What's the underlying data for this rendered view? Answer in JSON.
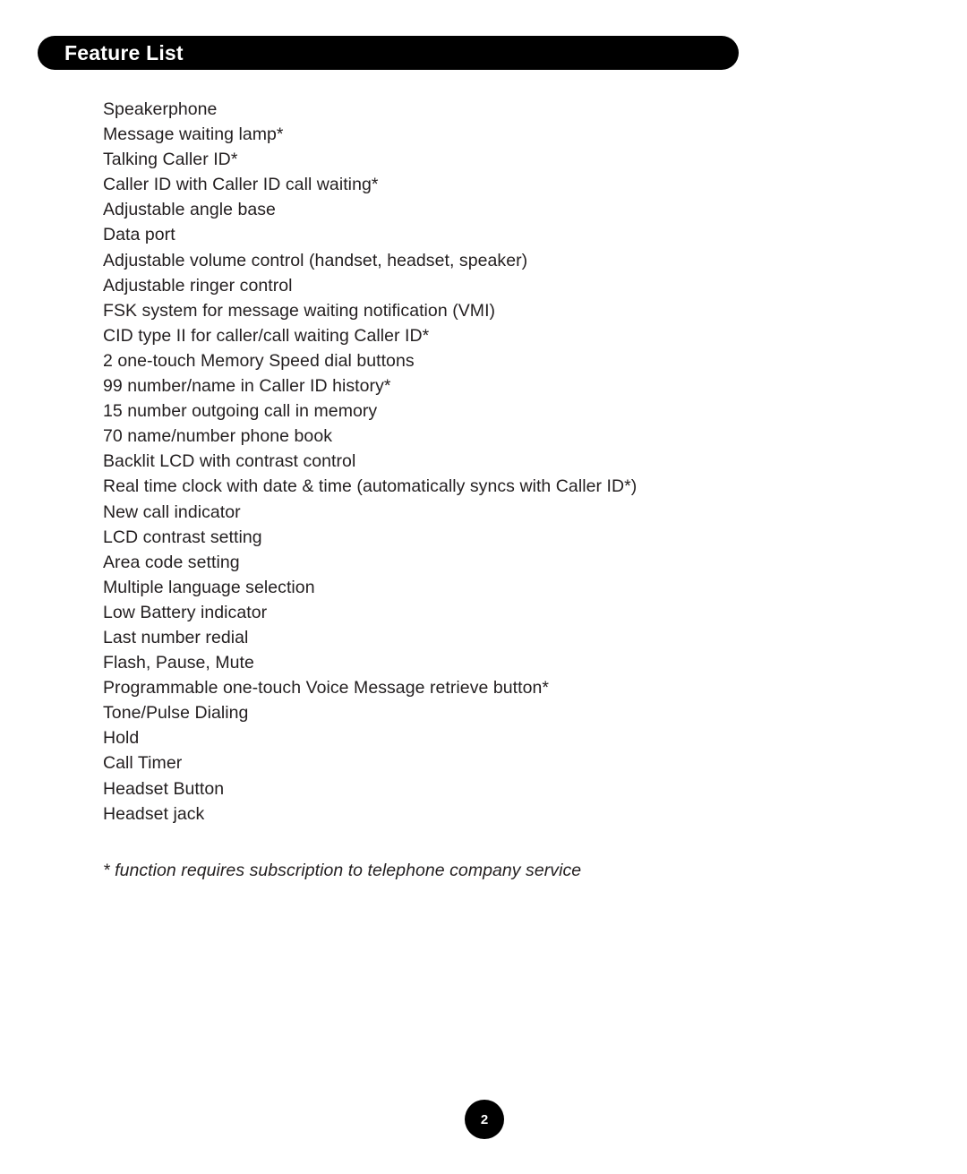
{
  "header": {
    "title": "Feature List",
    "background_color": "#000000",
    "text_color": "#ffffff"
  },
  "body_text_color": "#231f20",
  "page_background_color": "#ffffff",
  "features": [
    "Speakerphone",
    "Message waiting lamp*",
    "Talking Caller ID*",
    "Caller ID with Caller ID call waiting*",
    "Adjustable angle base",
    "Data port",
    "Adjustable volume control (handset, headset, speaker)",
    "Adjustable ringer control",
    "FSK system for message waiting notification (VMI)",
    "CID type II for caller/call waiting Caller ID*",
    "2 one-touch Memory Speed dial buttons",
    "99 number/name in Caller ID history*",
    "15 number outgoing call in memory",
    "70 name/number phone book",
    "Backlit LCD with contrast control",
    "Real time clock with date & time (automatically syncs with Caller ID*)",
    "New call indicator",
    "LCD contrast setting",
    "Area code setting",
    "Multiple language selection",
    "Low Battery indicator",
    "Last number redial",
    "Flash, Pause, Mute",
    "Programmable one-touch Voice Message retrieve button*",
    "Tone/Pulse Dialing",
    "Hold",
    "Call Timer",
    "Headset Button",
    "Headset jack"
  ],
  "footnote": "* function requires subscription to telephone company service",
  "page_number": "2"
}
